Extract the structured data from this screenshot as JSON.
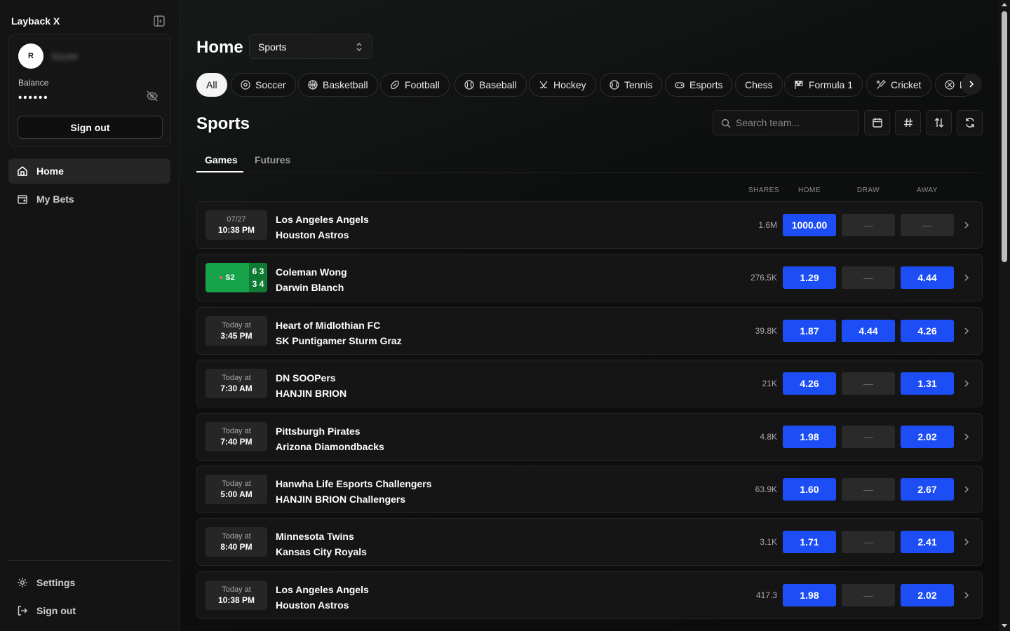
{
  "app": {
    "name": "Layback X"
  },
  "user": {
    "avatar_initial": "R",
    "username": "Sizzler",
    "balance_label": "Balance",
    "balance_masked": "••••••",
    "signout_label": "Sign out"
  },
  "nav": {
    "home": "Home",
    "my_bets": "My Bets",
    "settings": "Settings",
    "signout": "Sign out"
  },
  "header": {
    "title": "Home",
    "select_value": "Sports"
  },
  "chips": [
    "All",
    "Soccer",
    "Basketball",
    "Football",
    "Baseball",
    "Hockey",
    "Tennis",
    "Esports",
    "Chess",
    "Formula 1",
    "Cricket",
    "E"
  ],
  "section": {
    "title": "Sports",
    "search_placeholder": "Search team..."
  },
  "tabs": {
    "games": "Games",
    "futures": "Futures"
  },
  "columns": {
    "shares": "SHARES",
    "home": "HOME",
    "draw": "DRAW",
    "away": "AWAY"
  },
  "empty_odd": "—",
  "games": [
    {
      "date": "07/27",
      "time": "10:38 PM",
      "home": "Los Angeles Angels",
      "away": "Houston Astros",
      "shares": "1.6M",
      "odds_home": "1000.00",
      "odds_draw": "—",
      "odds_away": "—"
    },
    {
      "live": "S2",
      "score_top": "6 3",
      "score_bottom": "3 4",
      "home": "Coleman Wong",
      "away": "Darwin Blanch",
      "shares": "276.5K",
      "odds_home": "1.29",
      "odds_draw": "—",
      "odds_away": "4.44"
    },
    {
      "date": "Today at",
      "time": "3:45 PM",
      "home": "Heart of Midlothian FC",
      "away": "SK Puntigamer Sturm Graz",
      "shares": "39.8K",
      "odds_home": "1.87",
      "odds_draw": "4.44",
      "odds_away": "4.26"
    },
    {
      "date": "Today at",
      "time": "7:30 AM",
      "home": "DN SOOPers",
      "away": "HANJIN BRION",
      "shares": "21K",
      "odds_home": "4.26",
      "odds_draw": "—",
      "odds_away": "1.31"
    },
    {
      "date": "Today at",
      "time": "7:40 PM",
      "home": "Pittsburgh Pirates",
      "away": "Arizona Diamondbacks",
      "shares": "4.8K",
      "odds_home": "1.98",
      "odds_draw": "—",
      "odds_away": "2.02"
    },
    {
      "date": "Today at",
      "time": "5:00 AM",
      "home": "Hanwha Life Esports Challengers",
      "away": "HANJIN BRION Challengers",
      "shares": "63.9K",
      "odds_home": "1.60",
      "odds_draw": "—",
      "odds_away": "2.67"
    },
    {
      "date": "Today at",
      "time": "8:40 PM",
      "home": "Minnesota Twins",
      "away": "Kansas City Royals",
      "shares": "3.1K",
      "odds_home": "1.71",
      "odds_draw": "—",
      "odds_away": "2.41"
    },
    {
      "date": "Today at",
      "time": "10:38 PM",
      "home": "Los Angeles Angels",
      "away": "Houston Astros",
      "shares": "417.3",
      "odds_home": "1.98",
      "odds_draw": "—",
      "odds_away": "2.02"
    }
  ],
  "colors": {
    "accent_blue": "#1d4ef5",
    "live_green": "#16a34a",
    "background": "#0c0c0c"
  }
}
